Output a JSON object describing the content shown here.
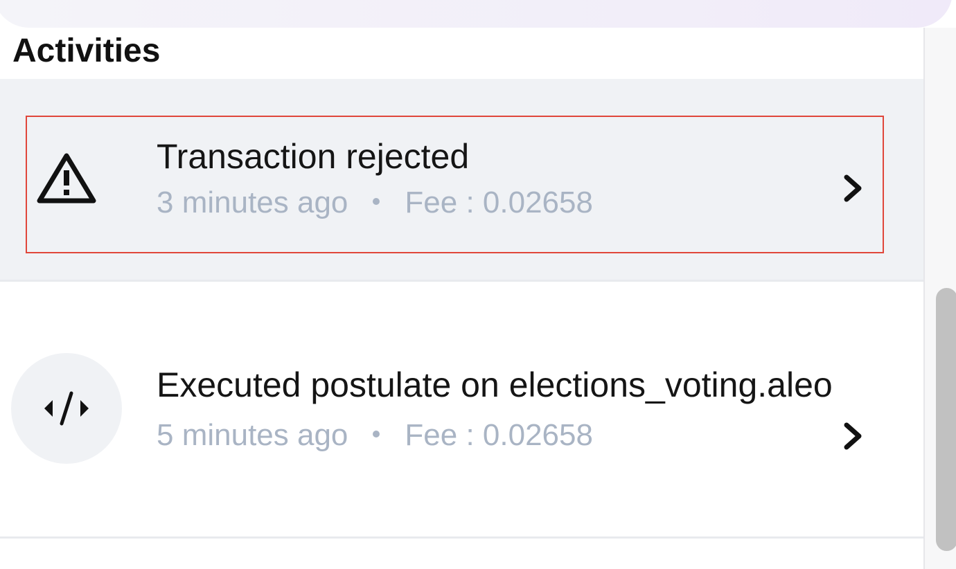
{
  "section": {
    "title": "Activities"
  },
  "activities": [
    {
      "icon": "warning-triangle-icon",
      "title": "Transaction rejected",
      "time": "3 minutes ago",
      "fee": "Fee : 0.02658"
    },
    {
      "icon": "code-icon",
      "title": "Executed postulate on elections_voting.aleo",
      "time": "5 minutes ago",
      "fee": "Fee : 0.02658"
    }
  ],
  "colors": {
    "focus_outline": "#e0463a",
    "muted_text": "#a9b4c4",
    "row_highlight": "#f0f2f5"
  }
}
